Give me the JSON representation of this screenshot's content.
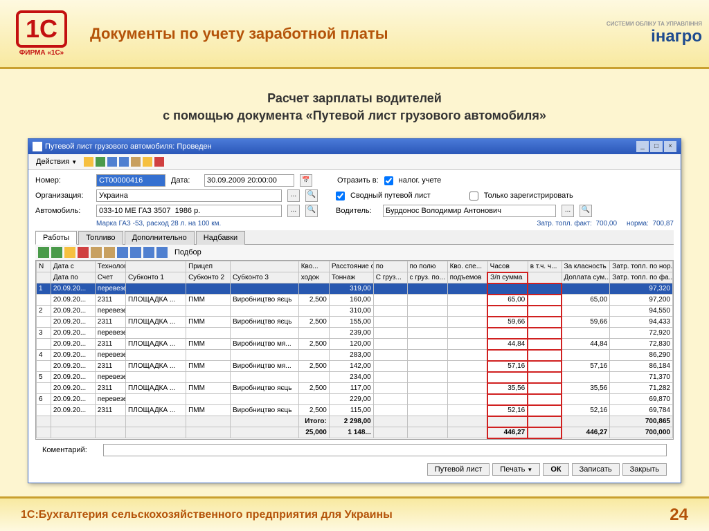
{
  "slide": {
    "title": "Документы по учету заработной платы",
    "subtitle_line1": "Расчет зарплаты водителей",
    "subtitle_line2": "с помощью документа «Путевой лист грузового автомобиля»",
    "logo_left": "1С",
    "logo_left_sub": "ФИРМА «1С»",
    "logo_right_sub": "СИСТЕМИ ОБЛІКУ ТА УПРАВЛІННЯ",
    "logo_right": "інагро",
    "footer": "1С:Бухгалтерия сельскохозяйственного предприятия для Украины",
    "page": "24"
  },
  "window": {
    "title": "Путевой лист грузового автомобиля: Проведен",
    "actions_label": "Действия",
    "form": {
      "number_label": "Номер:",
      "number": "СТ00000416",
      "date_label": "Дата:",
      "date": "30.09.2009 20:00:00",
      "reflect_label": "Отразить в:",
      "tax_label": "налог. учете",
      "org_label": "Организация:",
      "org": "Украина",
      "summary_label": "Сводный путевой лист",
      "only_reg_label": "Только зарегистрировать",
      "car_label": "Автомобиль:",
      "car": "033-10 МЕ ГАЗ 3507  1986 р.",
      "driver_label": "Водитель:",
      "driver": "Бурдонос Володимир Антонович",
      "info1": "Марка ГАЗ -53, расход 28 л. на 100 км.",
      "info2_a": "Затр. топл. факт:",
      "info2_av": "700,00",
      "info2_b": "норма:",
      "info2_bv": "700,87",
      "comment_label": "Коментарий:"
    },
    "tabs": [
      "Работы",
      "Топливо",
      "Дополнительно",
      "Надбавки"
    ],
    "tb2_label": "Подбор",
    "grid": {
      "headers1": [
        "N",
        "Дата с",
        "Технологическая операция",
        "",
        "Прицеп",
        "",
        "Кво...",
        "Расстояние общ.",
        "по",
        "по полю",
        "Кво. спе...",
        "Часов",
        "в т.ч. ч...",
        "За класность",
        "Затр. топл. по нор..."
      ],
      "headers2": [
        "",
        "Дата по",
        "Счет",
        "Субконто 1",
        "Субконто 2",
        "Субконто 3",
        "ходок",
        "Тоннаж",
        "С груз...",
        "с груз. по...",
        "подъемов",
        "З/п сумма",
        "",
        "Доплата сум...",
        "Затр. топл. по фа..."
      ],
      "rows": [
        [
          "1",
          "20.09.20...",
          "перевезення підстилки",
          "",
          "",
          "",
          "",
          "319,00",
          "",
          "",
          "",
          "",
          "",
          "",
          "97,320"
        ],
        [
          "",
          "20.09.20...",
          "2311",
          "ПЛОЩАДКА ...",
          "ПММ",
          "Виробництво яєць",
          "2,500",
          "160,00",
          "",
          "",
          "",
          "65,00",
          "",
          "65,00",
          "97,200"
        ],
        [
          "2",
          "20.09.20...",
          "перевезення підстилки",
          "",
          "",
          "",
          "",
          "310,00",
          "",
          "",
          "",
          "",
          "",
          "",
          "94,550"
        ],
        [
          "",
          "20.09.20...",
          "2311",
          "ПЛОЩАДКА ...",
          "ПММ",
          "Виробництво яєць",
          "2,500",
          "155,00",
          "",
          "",
          "",
          "59,66",
          "",
          "59,66",
          "94,433"
        ],
        [
          "3",
          "20.09.20...",
          "перевезення підстилки",
          "",
          "",
          "",
          "",
          "239,00",
          "",
          "",
          "",
          "",
          "",
          "",
          "72,920"
        ],
        [
          "",
          "20.09.20...",
          "2311",
          "ПЛОЩАДКА ...",
          "ПММ",
          "Виробництво мя...",
          "2,500",
          "120,00",
          "",
          "",
          "",
          "44,84",
          "",
          "44,84",
          "72,830"
        ],
        [
          "4",
          "20.09.20...",
          "перевезення підстилки",
          "",
          "",
          "",
          "",
          "283,00",
          "",
          "",
          "",
          "",
          "",
          "",
          "86,290"
        ],
        [
          "",
          "20.09.20...",
          "2311",
          "ПЛОЩАДКА ...",
          "ПММ",
          "Виробництво мя...",
          "2,500",
          "142,00",
          "",
          "",
          "",
          "57,16",
          "",
          "57,16",
          "86,184"
        ],
        [
          "5",
          "20.09.20...",
          "перевезення підстилки",
          "",
          "",
          "",
          "",
          "234,00",
          "",
          "",
          "",
          "",
          "",
          "",
          "71,370"
        ],
        [
          "",
          "20.09.20...",
          "2311",
          "ПЛОЩАДКА ...",
          "ПММ",
          "Виробництво яєць",
          "2,500",
          "117,00",
          "",
          "",
          "",
          "35,56",
          "",
          "35,56",
          "71,282"
        ],
        [
          "6",
          "20.09.20...",
          "перевезення підстилки",
          "",
          "",
          "",
          "",
          "229,00",
          "",
          "",
          "",
          "",
          "",
          "",
          "69,870"
        ],
        [
          "",
          "20.09.20...",
          "2311",
          "ПЛОЩАДКА ...",
          "ПММ",
          "Виробництво яєць",
          "2,500",
          "115,00",
          "",
          "",
          "",
          "52,16",
          "",
          "52,16",
          "69,784"
        ]
      ],
      "totals_label": "Итого:",
      "totals_r1": [
        "2 298,00",
        "",
        "",
        "",
        "",
        "",
        "",
        "700,865"
      ],
      "totals_r2": [
        "25,000",
        "1 148...",
        "",
        "",
        "",
        "446,27",
        "446,27",
        "700,000"
      ]
    },
    "buttons": {
      "sheet": "Путевой лист",
      "print": "Печать",
      "ok": "ОК",
      "save": "Записать",
      "close": "Закрыть"
    }
  }
}
